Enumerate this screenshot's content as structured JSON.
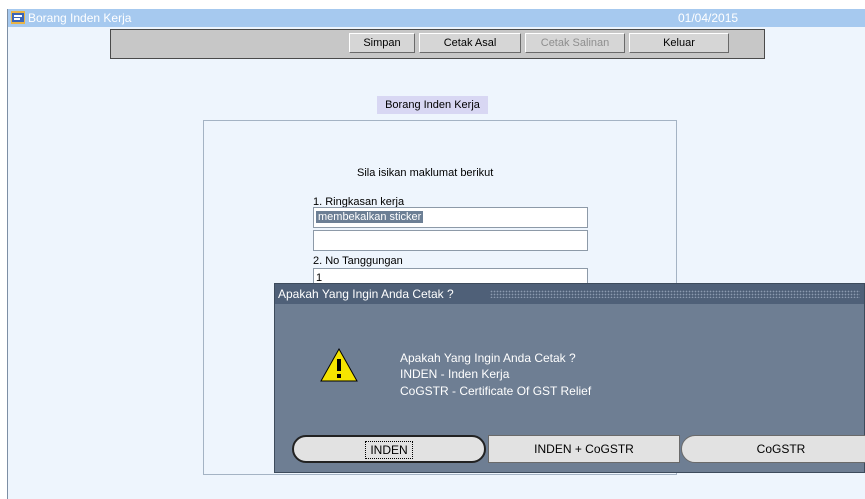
{
  "window": {
    "title": "Borang Inden Kerja",
    "date": "01/04/2015"
  },
  "toolbar": {
    "buttons": [
      {
        "label": "Simpan",
        "enabled": true
      },
      {
        "label": "Cetak Asal",
        "enabled": true
      },
      {
        "label": "Cetak Salinan",
        "enabled": false
      },
      {
        "label": "Keluar",
        "enabled": true
      }
    ]
  },
  "form": {
    "heading": "Borang Inden Kerja",
    "instruction": "Sila isikan maklumat berikut",
    "field1_label": "1. Ringkasan kerja",
    "field1_value": "membekalkan sticker",
    "field1_line2_value": "",
    "field2_label": "2. No Tanggungan",
    "field2_value": "1"
  },
  "dialog": {
    "title": "Apakah Yang Ingin Anda Cetak ?",
    "icon": "warning-icon",
    "message_lines": [
      "Apakah Yang Ingin Anda Cetak ?",
      "INDEN - Inden Kerja",
      "CoGSTR - Certificate Of GST Relief"
    ],
    "buttons": [
      {
        "label": "INDEN",
        "focused": true
      },
      {
        "label": "INDEN + CoGSTR",
        "focused": false
      },
      {
        "label": "CoGSTR",
        "focused": false
      }
    ]
  },
  "colors": {
    "titlebar": "#a6c9ef",
    "window_bg": "#eef5fd",
    "dialog_bg": "#6e7e93",
    "dialog_titlebar": "#4f6078",
    "warning": "#f5e400"
  }
}
